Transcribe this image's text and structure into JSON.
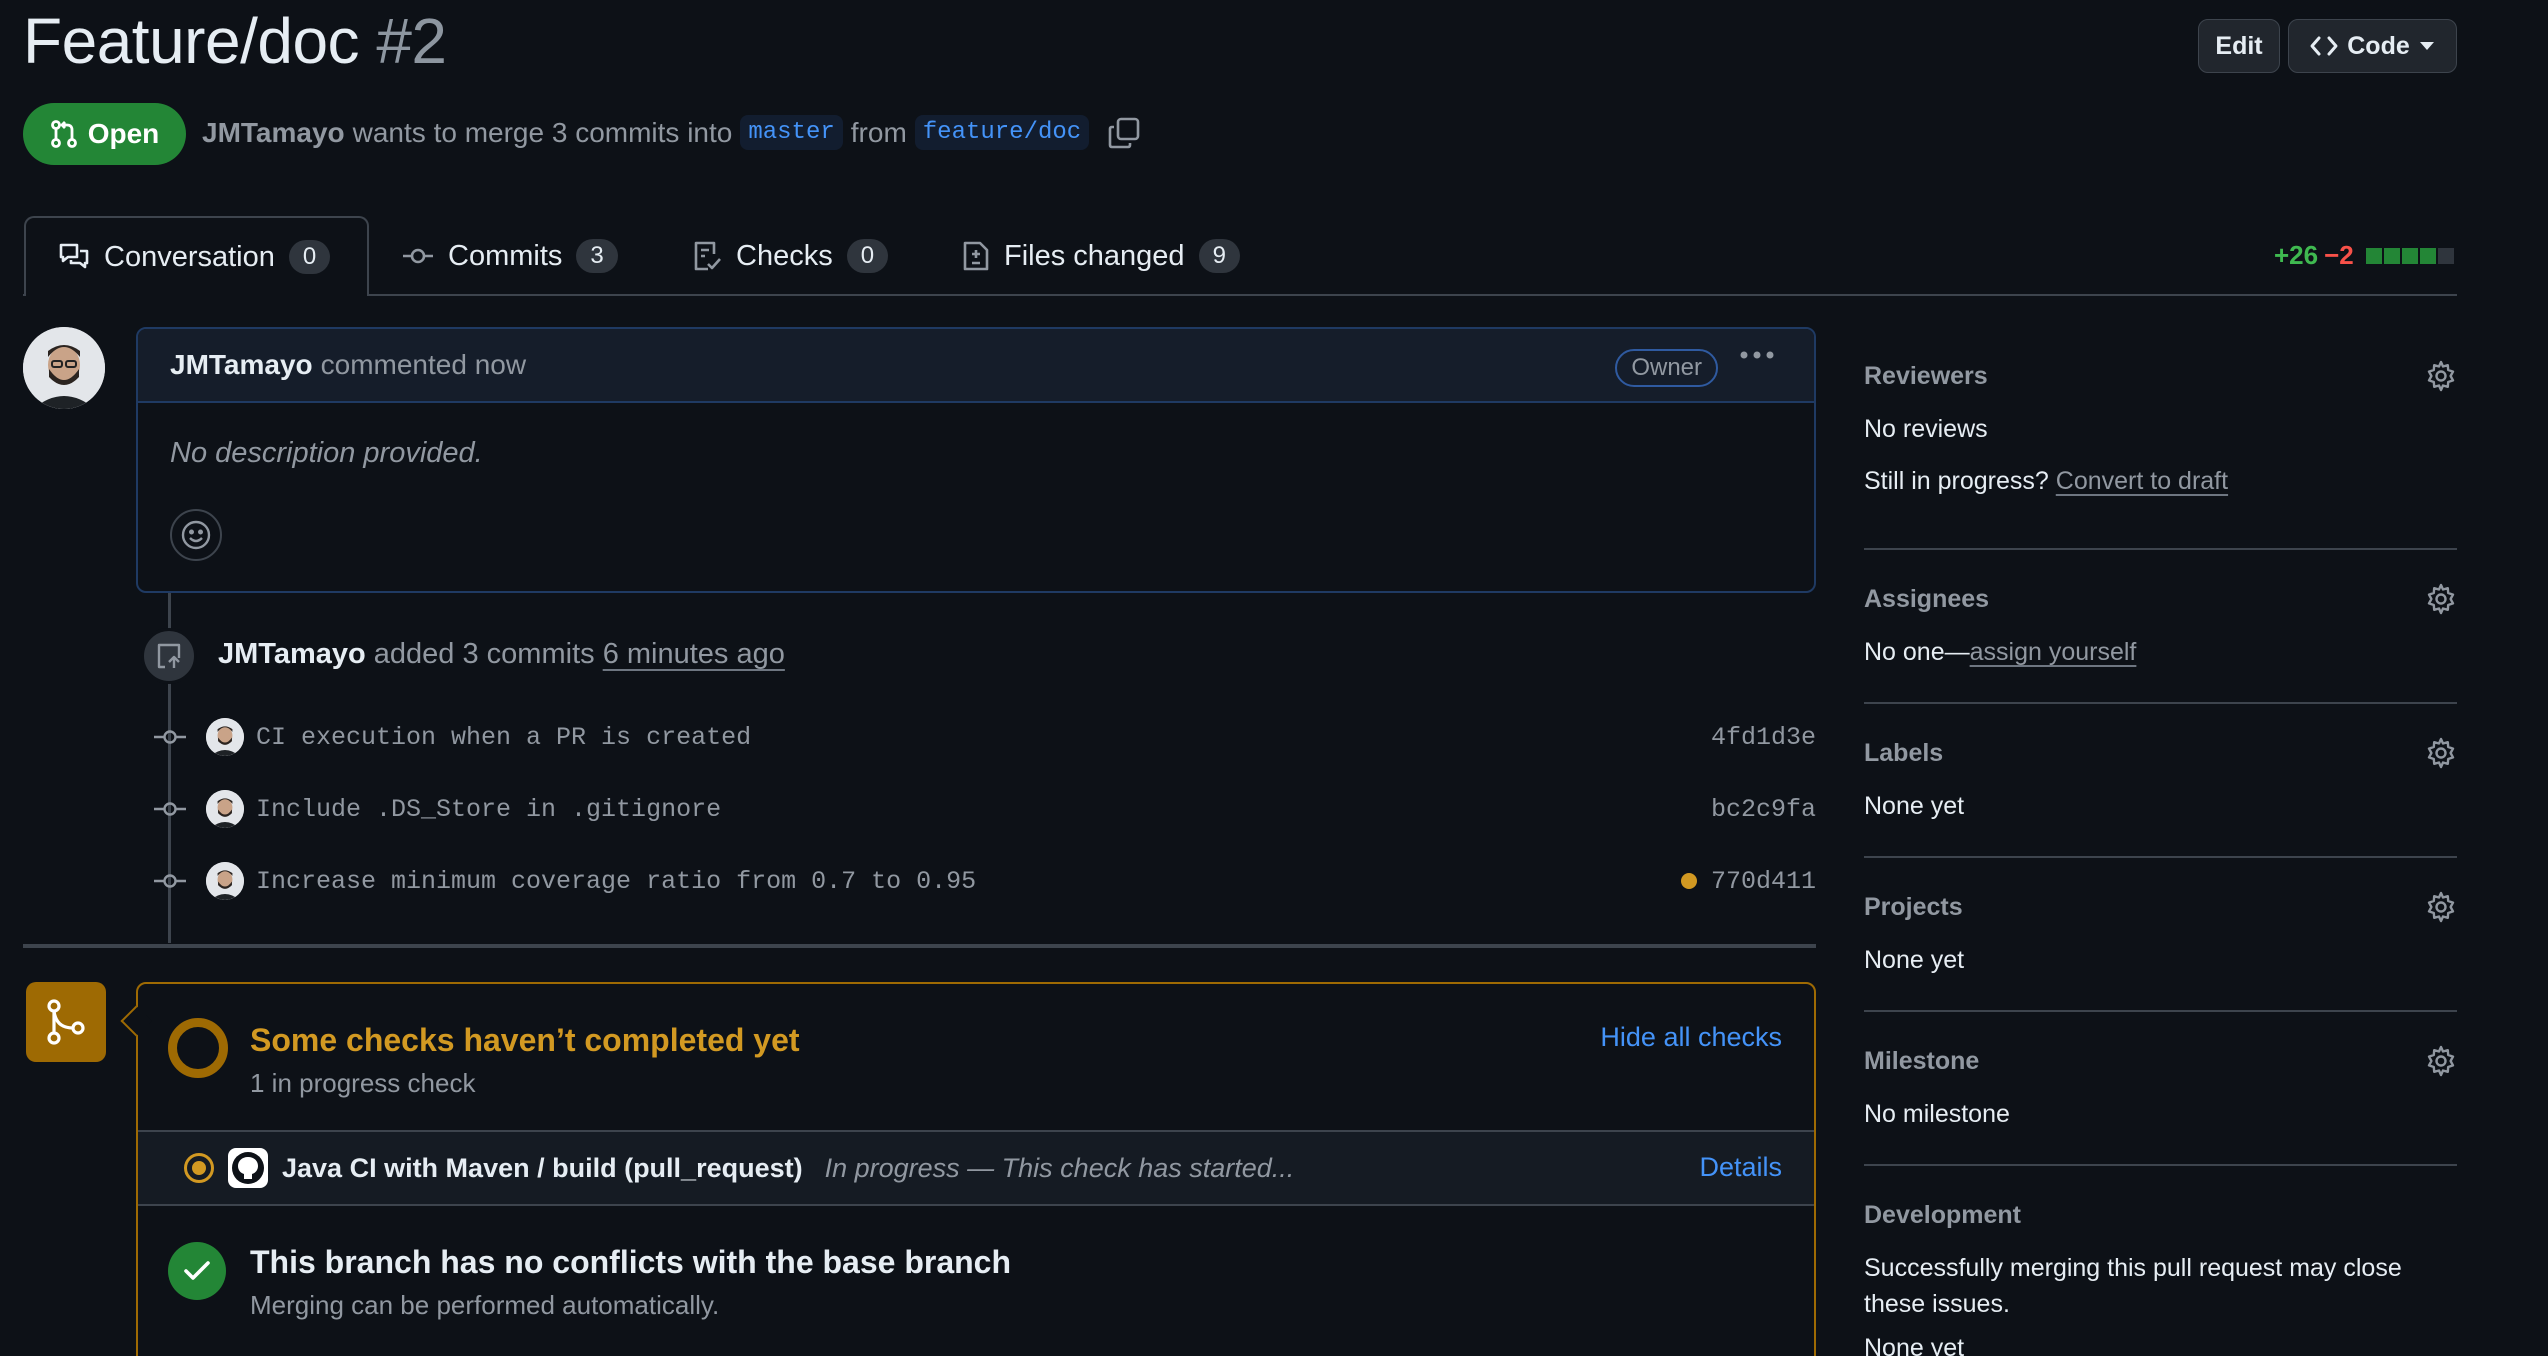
{
  "header": {
    "title": "Feature/doc",
    "number": "#2",
    "edit_label": "Edit",
    "code_label": "Code",
    "state_label": "Open",
    "author": "JMTamayo",
    "merge_text": "wants to merge 3 commits into",
    "base_branch": "master",
    "from_text": "from",
    "head_branch": "feature/doc"
  },
  "tabs": [
    {
      "label": "Conversation",
      "count": "0",
      "icon": "comment-discussion-icon"
    },
    {
      "label": "Commits",
      "count": "3",
      "icon": "git-commit-icon"
    },
    {
      "label": "Checks",
      "count": "0",
      "icon": "checklist-icon"
    },
    {
      "label": "Files changed",
      "count": "9",
      "icon": "file-diff-icon"
    }
  ],
  "diffstat": {
    "additions": "+26",
    "deletions": "−2"
  },
  "comment": {
    "author": "JMTamayo",
    "action": "commented now",
    "role": "Owner",
    "body": "No description provided."
  },
  "timeline": {
    "author": "JMTamayo",
    "action": "added 3 commits",
    "when": "6 minutes ago",
    "commits": [
      {
        "message": "CI execution when a PR is created",
        "sha": "4fd1d3e",
        "pending": false
      },
      {
        "message": "Include .DS_Store in .gitignore",
        "sha": "bc2c9fa",
        "pending": false
      },
      {
        "message": "Increase minimum coverage ratio from 0.7 to 0.95",
        "sha": "770d411",
        "pending": true
      }
    ]
  },
  "merge_box": {
    "checks_title": "Some checks haven’t completed yet",
    "checks_sub": "1 in progress check",
    "hide_label": "Hide all checks",
    "check_name": "Java CI with Maven / build (pull_request)",
    "check_status": "In progress — This check has started...",
    "details_label": "Details",
    "conflict_title": "This branch has no conflicts with the base branch",
    "conflict_sub": "Merging can be performed automatically."
  },
  "sidebar": {
    "reviewers": {
      "heading": "Reviewers",
      "value": "No reviews",
      "prompt": "Still in progress?",
      "link": "Convert to draft"
    },
    "assignees": {
      "heading": "Assignees",
      "value": "No one—",
      "link": "assign yourself"
    },
    "labels": {
      "heading": "Labels",
      "value": "None yet"
    },
    "projects": {
      "heading": "Projects",
      "value": "None yet"
    },
    "milestone": {
      "heading": "Milestone",
      "value": "No milestone"
    },
    "development": {
      "heading": "Development",
      "value": "Successfully merging this pull request may close these issues.",
      "extra": "None yet"
    }
  },
  "colors": {
    "accent": "#4493f8",
    "success": "#238636",
    "attention": "#d29922",
    "danger": "#f85149"
  }
}
